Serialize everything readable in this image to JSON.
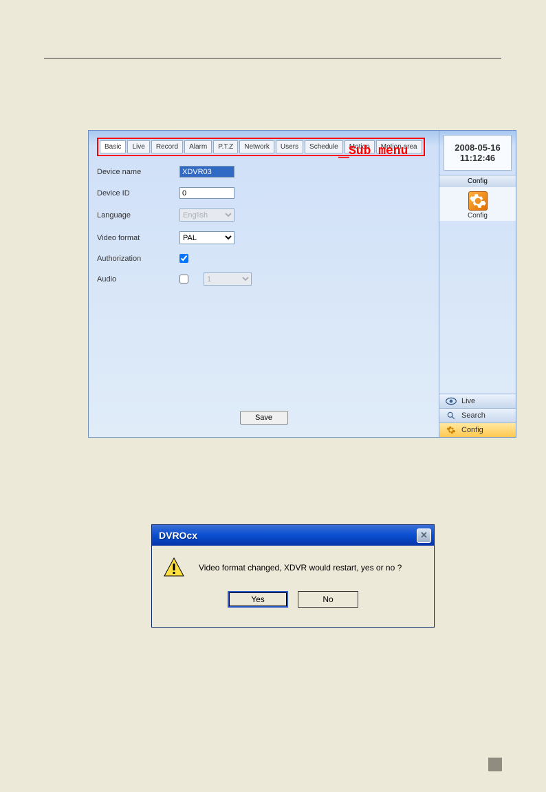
{
  "tabs": {
    "items": [
      "Basic",
      "Live",
      "Record",
      "Alarm",
      "P.T.Z",
      "Network",
      "Users",
      "Schedule",
      "Motion",
      "Motion area"
    ],
    "active": 0
  },
  "sub_menu_label": "Sub menu",
  "form": {
    "device_name": {
      "label": "Device name",
      "value": "XDVR03"
    },
    "device_id": {
      "label": "Device ID",
      "value": "0"
    },
    "language": {
      "label": "Language",
      "value": "English",
      "disabled": true
    },
    "video_format": {
      "label": "Video format",
      "value": "PAL"
    },
    "authorization": {
      "label": "Authorization",
      "checked": true
    },
    "audio": {
      "label": "Audio",
      "checked": false,
      "select_value": "1",
      "select_disabled": true
    },
    "save_label": "Save"
  },
  "right": {
    "date": "2008-05-16",
    "time": "11:12:46",
    "config_header": "Config",
    "config_icon_label": "Config",
    "nav": {
      "live": "Live",
      "search": "Search",
      "config": "Config"
    }
  },
  "dialog": {
    "title": "DVROcx",
    "message": "Video format changed, XDVR would restart, yes or no ?",
    "yes": "Yes",
    "no": "No"
  }
}
